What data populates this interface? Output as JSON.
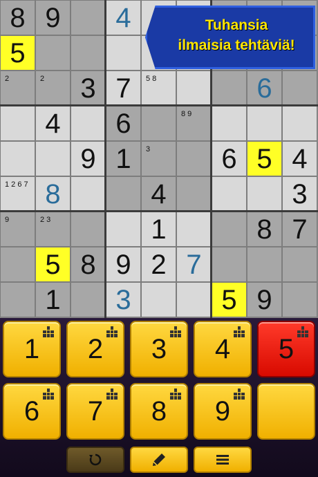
{
  "banner": {
    "line1": "Tuhansia",
    "line2": "ilmaisia tehtäviä!"
  },
  "colors": {
    "cell_light": "#d9d9d9",
    "cell_dark": "#a7a7a7",
    "highlight": "#ffff26",
    "key_yellow": "#f0b000",
    "key_red": "#d80a00",
    "given_blue": "#2a6c9a"
  },
  "grid": {
    "rows": [
      [
        "8",
        "9",
        "",
        "4",
        "",
        "",
        "",
        "",
        ""
      ],
      [
        "5",
        "",
        "",
        "",
        "",
        "",
        "",
        "",
        ""
      ],
      [
        "",
        "",
        "3",
        "7",
        "",
        "",
        "",
        "6",
        ""
      ],
      [
        "",
        "4",
        "",
        "6",
        "",
        "",
        "",
        "",
        ""
      ],
      [
        "",
        "",
        "9",
        "1",
        "",
        "",
        "6",
        "5",
        "4"
      ],
      [
        "",
        "8",
        "",
        "",
        "4",
        "",
        "",
        "",
        "3"
      ],
      [
        "",
        "",
        "",
        "",
        "1",
        "",
        "",
        "8",
        "7"
      ],
      [
        "",
        "5",
        "8",
        "9",
        "2",
        "7",
        "",
        "",
        ""
      ],
      [
        "",
        "1",
        "",
        "3",
        "",
        "",
        "5",
        "9",
        ""
      ]
    ],
    "notes": {
      "2-0": "2",
      "2-1": "2",
      "2-4": "5 8",
      "3-5": "8 9",
      "4-4": "3",
      "5-0": "1 2 6 7",
      "6-0": "9",
      "6-1": "2 3"
    }
  },
  "keypad": {
    "keys": [
      {
        "label": "1"
      },
      {
        "label": "2"
      },
      {
        "label": "3"
      },
      {
        "label": "4"
      },
      {
        "label": "5",
        "active": true
      },
      {
        "label": "6"
      },
      {
        "label": "7"
      },
      {
        "label": "8"
      },
      {
        "label": "9"
      },
      {
        "label": "",
        "icon": "eraser-icon"
      }
    ]
  },
  "toolbar": {
    "undo_icon": "undo-icon",
    "pencil_icon": "pencil-icon",
    "menu_icon": "menu-icon"
  }
}
